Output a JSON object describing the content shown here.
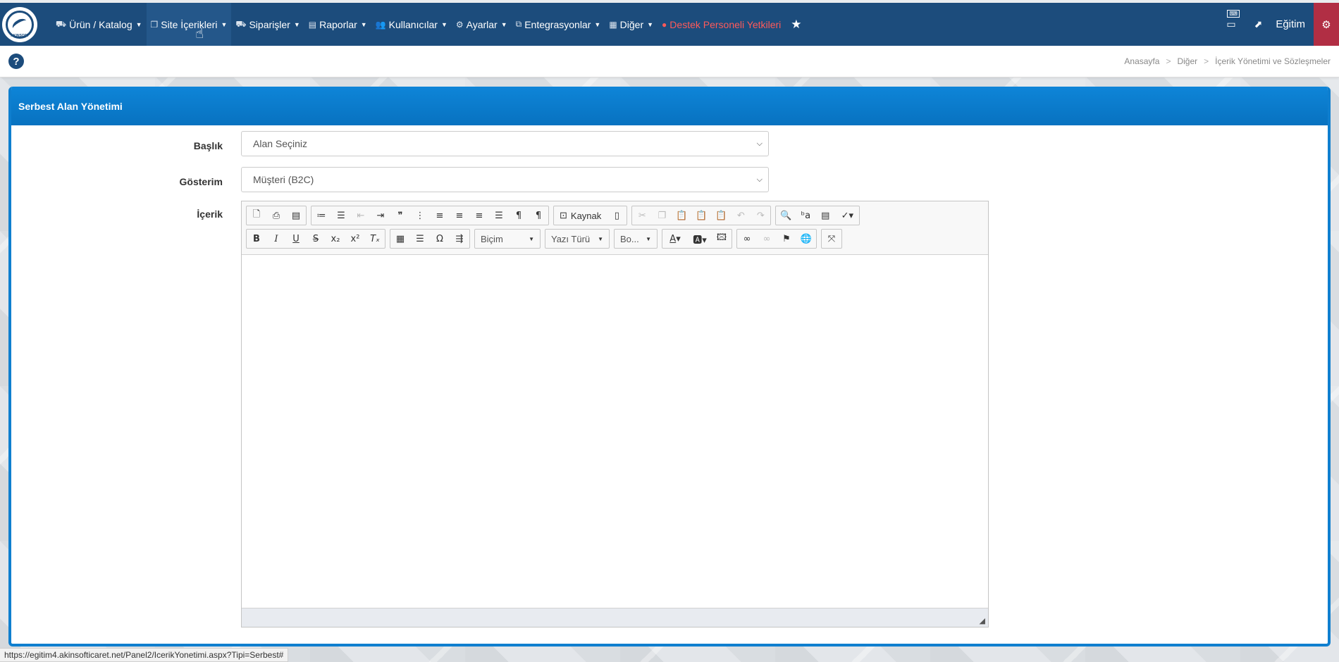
{
  "nav": {
    "logo_text": "AKINSOFT",
    "items": [
      {
        "label": "Ürün / Katalog",
        "icon": "products-icon",
        "glyph": "⛟"
      },
      {
        "label": "Site İçerikleri",
        "icon": "copy-icon",
        "glyph": "❐"
      },
      {
        "label": "Siparişler",
        "icon": "truck-icon",
        "glyph": "⛟"
      },
      {
        "label": "Raporlar",
        "icon": "file-icon",
        "glyph": "▤"
      },
      {
        "label": "Kullanıcılar",
        "icon": "users-icon",
        "glyph": "👥"
      },
      {
        "label": "Ayarlar",
        "icon": "cogs-icon",
        "glyph": "⚙"
      },
      {
        "label": "Entegrasyonlar",
        "icon": "sitemap-icon",
        "glyph": "⧉"
      },
      {
        "label": "Diğer",
        "icon": "building-icon",
        "glyph": "▦"
      }
    ],
    "support_label": "Destek Personeli Yetkileri",
    "user_label": "Eğitim",
    "keyboard_badge": "⌨"
  },
  "breadcrumb": {
    "home": "Anasayfa",
    "level1": "Diğer",
    "level2": "İçerik Yönetimi ve Sözleşmeler"
  },
  "panel": {
    "title": "Serbest Alan Yönetimi",
    "baslik_label": "Başlık",
    "baslik_value": "Alan Seçiniz",
    "gosterim_label": "Gösterim",
    "gosterim_value": "Müşteri (B2C)",
    "icerik_label": "İçerik"
  },
  "editor": {
    "source_label": "Kaynak",
    "format_combo": "Biçim",
    "font_combo": "Yazı Türü",
    "size_combo": "Bo..."
  },
  "status_url": "https://egitim4.akinsofticaret.net/Panel2/IcerikYonetimi.aspx?Tipi=Serbest#",
  "colors": {
    "nav_bg": "#1c4c7c",
    "panel_accent": "#0f7fcf",
    "danger": "#ff5a5a",
    "gear_box": "#b12e44"
  }
}
